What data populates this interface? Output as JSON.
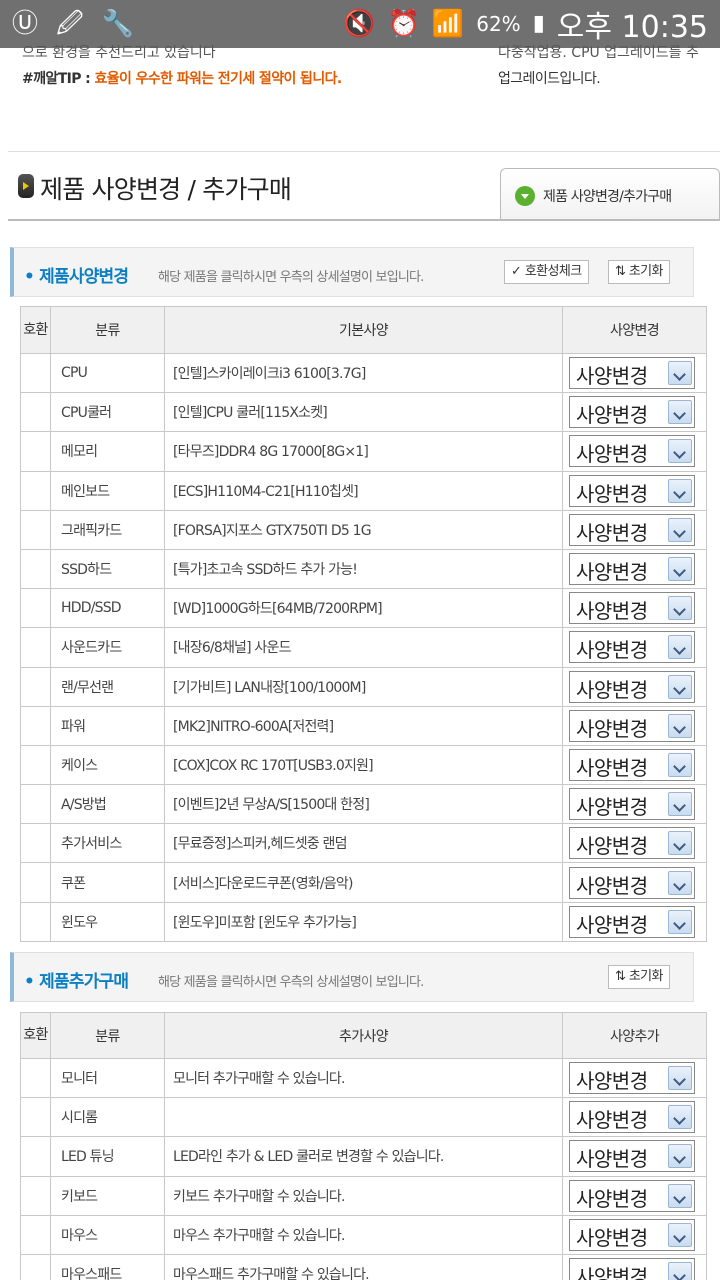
{
  "status_bar": {
    "left_icons": [
      "app-u-icon",
      "link-icon",
      "wrench-icon"
    ],
    "right_icons": [
      "silent-icon",
      "alarm-icon",
      "wifi-icon",
      "signal-icon",
      "battery-icon"
    ],
    "battery": "62%",
    "time": "오후 10:35"
  },
  "top": {
    "cut_left": "으로 환경을 추천드리고 있습니다",
    "cut_right": "다중작업용. CPU 업그레이드를 추",
    "tip_label": "#깨알TIP : ",
    "tip_text": "효율이 우수한 파워는 전기세 절약이 됩니다.",
    "right_text": "업그레이드입니다."
  },
  "section": {
    "title": "제품 사양변경 / 추가구매",
    "tab": "제품 사양변경/추가구매"
  },
  "spec_panel": {
    "title": "• 제품사양변경",
    "desc": "해당 제품을 클릭하시면 우측의 상세설명이 보입니다.",
    "check_btn": "✓ 호환성체크",
    "reset_btn": "⇅ 초기화"
  },
  "spec_table": {
    "headers": [
      "호환",
      "분류",
      "기본사양",
      "사양변경"
    ],
    "rows": [
      {
        "category": "CPU",
        "spec": "[인텔]스카이레이크i3 6100[3.7G]",
        "select": "사양변경"
      },
      {
        "category": "CPU쿨러",
        "spec": "[인텔]CPU 쿨러[115X소켓]",
        "select": "사양변경"
      },
      {
        "category": "메모리",
        "spec": "[타무즈]DDR4 8G 17000[8G×1]",
        "select": "사양변경"
      },
      {
        "category": "메인보드",
        "spec": "[ECS]H110M4-C21[H110칩셋]",
        "select": "사양변경"
      },
      {
        "category": "그래픽카드",
        "spec": "[FORSA]지포스 GTX750TI D5 1G",
        "select": "사양변경"
      },
      {
        "category": "SSD하드",
        "spec": "[특가]초고속 SSD하드 추가 가능!",
        "select": "사양변경"
      },
      {
        "category": "HDD/SSD",
        "spec": "[WD]1000G하드[64MB/7200RPM]",
        "select": "사양변경"
      },
      {
        "category": "사운드카드",
        "spec": "[내장6/8채널] 사운드",
        "select": "사양변경"
      },
      {
        "category": "랜/무선랜",
        "spec": "[기가비트] LAN내장[100/1000M]",
        "select": "사양변경"
      },
      {
        "category": "파워",
        "spec": "[MK2]NITRO-600A[저전력]",
        "select": "사양변경"
      },
      {
        "category": "케이스",
        "spec": "[COX]COX RC 170T[USB3.0지원]",
        "select": "사양변경"
      },
      {
        "category": "A/S방법",
        "spec": "[이벤트]2년 무상A/S[1500대 한정]",
        "select": "사양변경"
      },
      {
        "category": "추가서비스",
        "spec": "[무료증정]스피커,헤드셋중 랜덤",
        "select": "사양변경"
      },
      {
        "category": "쿠폰",
        "spec": "[서비스]다운로드쿠폰(영화/음악)",
        "select": "사양변경"
      },
      {
        "category": "윈도우",
        "spec": "[윈도우]미포함 [윈도우 추가가능]",
        "select": "사양변경"
      }
    ]
  },
  "add_panel": {
    "title": "• 제품추가구매",
    "desc": "해당 제품을 클릭하시면 우측의 상세설명이 보입니다.",
    "reset_btn": "⇅ 초기화"
  },
  "add_table": {
    "headers": [
      "호환",
      "분류",
      "추가사양",
      "사양추가"
    ],
    "rows": [
      {
        "category": "모니터",
        "spec": "모니터 추가구매할 수 있습니다.",
        "select": "사양변경"
      },
      {
        "category": "시디롬",
        "spec": "",
        "select": "사양변경"
      },
      {
        "category": "LED 튜닝",
        "spec": "LED라인 추가 & LED 쿨러로 변경할 수 있습니다.",
        "select": "사양변경"
      },
      {
        "category": "키보드",
        "spec": "키보드 추가구매할 수 있습니다.",
        "select": "사양변경"
      },
      {
        "category": "마우스",
        "spec": "마우스 추가구매할 수 있습니다.",
        "select": "사양변경"
      },
      {
        "category": "마우스패드",
        "spec": "마우스패드 추가구매할 수 있습니다.",
        "select": "사양변경"
      }
    ]
  },
  "colors": {
    "accent_blue": "#0b7fc4",
    "tip_orange": "#e05a00",
    "status_bar": "#707070"
  }
}
